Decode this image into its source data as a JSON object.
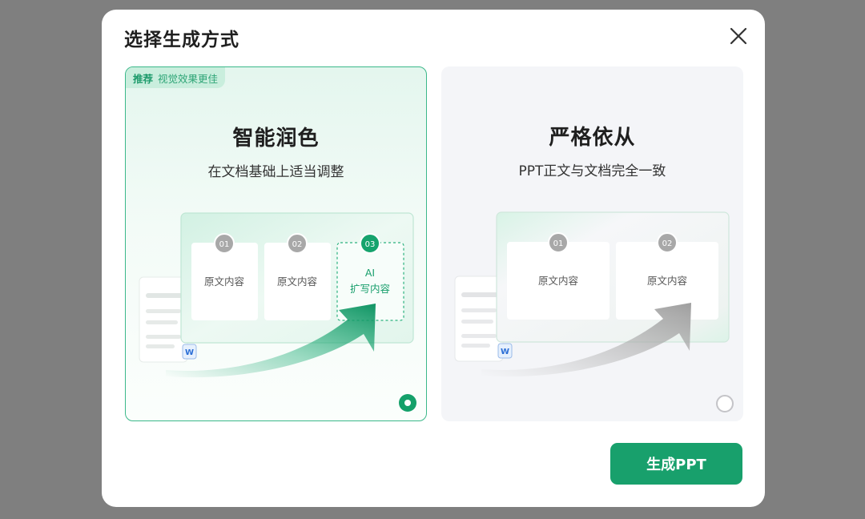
{
  "dialog": {
    "title": "选择生成方式",
    "close_icon": "close-icon"
  },
  "options": [
    {
      "badge_strong": "推荐",
      "badge_text": "视觉效果更佳",
      "title": "智能润色",
      "subtitle": "在文档基础上适当调整",
      "selected": true,
      "steps": [
        {
          "num": "01",
          "text": "原文内容"
        },
        {
          "num": "02",
          "text": "原文内容"
        },
        {
          "num": "03",
          "text_line1": "AI",
          "text_line2": "扩写内容"
        }
      ],
      "doc_icon_letter": "W"
    },
    {
      "title": "严格依从",
      "subtitle": "PPT正文与文档完全一致",
      "selected": false,
      "steps": [
        {
          "num": "01",
          "text": "原文内容"
        },
        {
          "num": "02",
          "text": "原文内容"
        }
      ],
      "doc_icon_letter": "W"
    }
  ],
  "actions": {
    "generate_label": "生成PPT"
  },
  "colors": {
    "accent": "#18a06c",
    "accent_light": "#c9eedd",
    "overlay": "#7f7f7f"
  }
}
